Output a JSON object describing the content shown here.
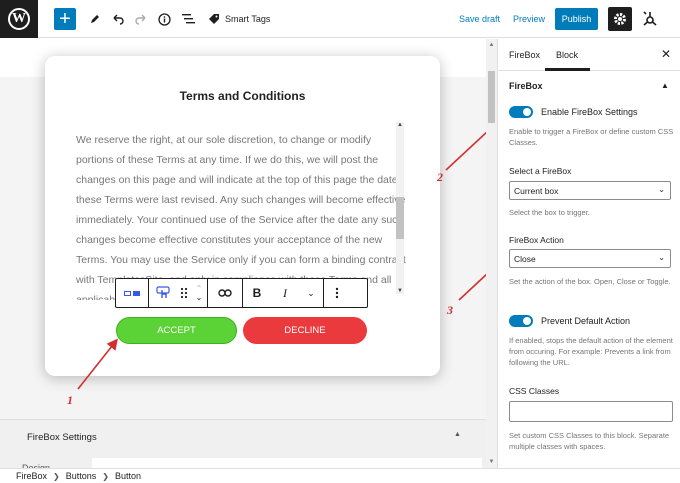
{
  "topbar": {
    "logo": "W",
    "add_icon": "plus-icon",
    "smart_tags_label": "Smart Tags",
    "save_draft_label": "Save draft",
    "preview_label": "Preview",
    "publish_label": "Publish"
  },
  "modal": {
    "title": "Terms and Conditions",
    "body": "We reserve the right, at our sole discretion, to change or modify portions of these Terms at any time. If we do this, we will post the changes on this page and will indicate at the top of this page the date these Terms were last revised. Any such changes will become effective immediately. Your continued use of the Service after the date any such changes become effective constitutes your acceptance of the new Terms. You may use the Service only if you can form a binding contract with TemplatesSite, and only in compliance with these Terms and all applicable local, state, national, and",
    "accept_label": "ACCEPT",
    "decline_label": "DECLINE"
  },
  "annotations": [
    "1",
    "2",
    "3"
  ],
  "bottom_panel": {
    "title": "FireBox Settings",
    "design_label": "Design"
  },
  "breadcrumb": [
    "FireBox",
    "Buttons",
    "Button"
  ],
  "sidebar": {
    "tabs": [
      "FireBox",
      "Block"
    ],
    "active_tab": "Block",
    "panel_title": "FireBox",
    "enable_toggle": {
      "label": "Enable FireBox Settings",
      "on": true
    },
    "enable_help": "Enable to trigger a FireBox or define custom CSS Classes.",
    "select_firebox": {
      "label": "Select a FireBox",
      "value": "Current box",
      "help": "Select the box to trigger."
    },
    "firebox_action": {
      "label": "FireBox Action",
      "value": "Close",
      "help": "Set the action of the box. Open, Close or Toggle."
    },
    "prevent_toggle": {
      "label": "Prevent Default Action",
      "on": true
    },
    "prevent_help": "If enabled, stops the default action of the element from occuring. For example: Prevents a link from following the URL.",
    "css_classes": {
      "label": "CSS Classes",
      "value": "",
      "help": "Set custom CSS Classes to this block. Separate multiple classes with spaces."
    }
  },
  "colors": {
    "accent": "#007cba",
    "accept": "#5bd235",
    "decline": "#ea3a3e",
    "annotation": "#d32f2f"
  }
}
